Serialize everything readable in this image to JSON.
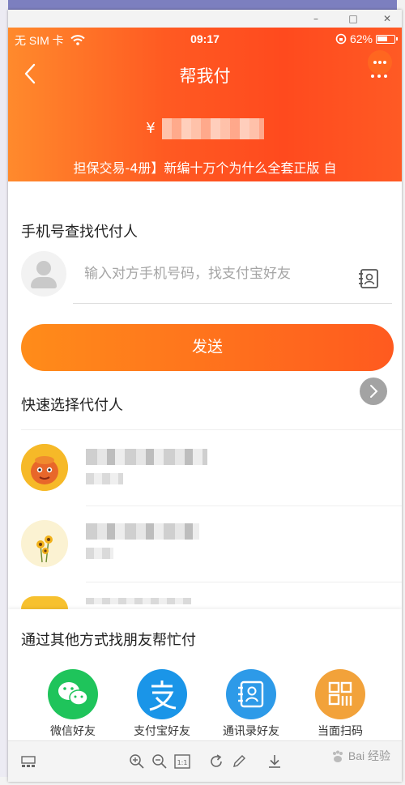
{
  "status_bar": {
    "carrier": "无 SIM 卡",
    "time": "09:17",
    "battery": "62%",
    "battery_level": 0.62
  },
  "header": {
    "title": "帮我付",
    "currency_symbol": "¥",
    "description": "担保交易-4册】新编十万个为什么全套正版 自"
  },
  "phone_search": {
    "section_title": "手机号查找代付人",
    "placeholder": "输入对方手机号码，找支付宝好友",
    "send_label": "发送"
  },
  "quick_select": {
    "section_title": "快速选择代付人"
  },
  "other_methods": {
    "section_title": "通过其他方式找朋友帮忙付",
    "items": [
      {
        "label": "微信好友",
        "icon": "wechat-icon",
        "color": "#1fc45b"
      },
      {
        "label": "支付宝好友",
        "icon": "alipay-icon",
        "color": "#1a95e8"
      },
      {
        "label": "通讯录好友",
        "icon": "contacts-icon",
        "color": "#2d9ae8"
      },
      {
        "label": "当面扫码",
        "icon": "qr-code-icon",
        "color": "#f2a23a"
      }
    ]
  },
  "watermark": "Bai 经验",
  "colors": {
    "brand_orange": "#ff5a22",
    "button_start": "#ff8c1a",
    "button_end": "#ff5a1f"
  }
}
